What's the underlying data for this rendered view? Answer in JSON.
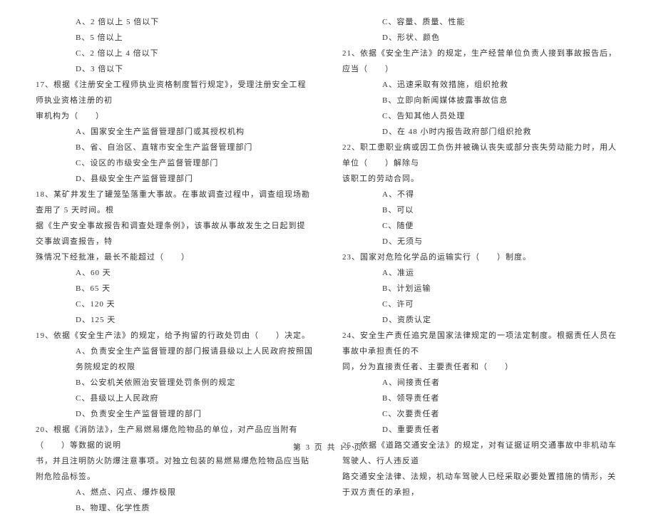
{
  "left": {
    "opts_pre17": [
      "A、2 倍以上 5 倍以下",
      "B、5 倍以上",
      "C、2 倍以上 4 倍以下",
      "D、3 倍以下"
    ],
    "q17": {
      "line1": "17、根据《注册安全工程师执业资格制度暂行规定》，受理注册安全工程师执业资格注册的初",
      "line2": "审机构为（　　）",
      "opts": [
        "A、国家安全生产监督管理部门或其授权机构",
        "B、省、自治区、直辖市安全生产监督管理部门",
        "C、设区的市级安全生产监督管理部门",
        "D、县级安全生产监督管理部门"
      ]
    },
    "q18": {
      "line1": "18、某矿井发生了罐笼坠落重大事故。在事故调查过程中，调查组现场勘查用了 5 天时间。根",
      "line2": "据《生产安全事故报告和调查处理条例》，该事故从事故发生之日起到提交事故调查报告，特",
      "line3": "殊情况下经批准，最长不能超过（　　）",
      "opts": [
        "A、60 天",
        "B、65 天",
        "C、120 天",
        "D、125 天"
      ]
    },
    "q19": {
      "line1": "19、依据《安全生产法》的规定，给予拘留的行政处罚由（　　）决定。",
      "opts": [
        "A、负责安全生产监督管理的部门报请县级以上人民政府按照国务院规定的权限",
        "B、公安机关依照治安管理处罚条例的规定",
        "C、县级以上人民政府",
        "D、负责安全生产监督管理的部门"
      ]
    },
    "q20": {
      "line1": "20、根据《消防法》，生产易燃易爆危险物品的单位，对产品应当附有（　　）等数据的说明",
      "line2": "书，并且注明防火防爆注意事项。对独立包装的易燃易爆危险物品应当贴附危险品标签。",
      "opts": [
        "A、燃点、闪点、爆炸极限",
        "B、物理、化学性质"
      ]
    }
  },
  "right": {
    "q20_cont": {
      "opts": [
        "C、容量、质量、性能",
        "D、形状、颜色"
      ]
    },
    "q21": {
      "line1": "21、依据《安全生产法》的规定，生产经营单位负责人接到事故报告后，应当（　　）",
      "opts": [
        "A、迅速采取有效措施，组织抢救",
        "B、立即向新闻媒体披露事故信息",
        "C、告知其他人员处理",
        "D、在 48 小时内报告政府部门组织抢救"
      ]
    },
    "q22": {
      "line1": "22、职工患职业病或因工负伤并被确认丧失或部分丧失劳动能力时，用人单位（　　）解除与",
      "line2": "该职工的劳动合同。",
      "opts": [
        "A、不得",
        "B、可以",
        "C、随便",
        "D、无须与"
      ]
    },
    "q23": {
      "line1": "23、国家对危险化学品的运输实行（　　）制度。",
      "opts": [
        "A、准运",
        "B、计划运输",
        "C、许可",
        "D、资质认定"
      ]
    },
    "q24": {
      "line1": "24、安全生产责任追究是国家法律规定的一项法定制度。根据责任人员在事故中承担责任的不",
      "line2": "同，分为直接责任者、主要责任者和（　　）",
      "opts": [
        "A、间接责任者",
        "B、领导责任者",
        "C、次要责任者",
        "D、重要责任者"
      ]
    },
    "q25": {
      "line1": "25、依据《道路交通安全法》的规定，对有证据证明交通事故中非机动车驾驶人、行人违反道",
      "line2": "路交通安全法律、法规，机动车驾驶人已经采取必要处置措施的情形，关于双方责任的承担，"
    }
  },
  "footer": "第 3 页 共 13 页"
}
